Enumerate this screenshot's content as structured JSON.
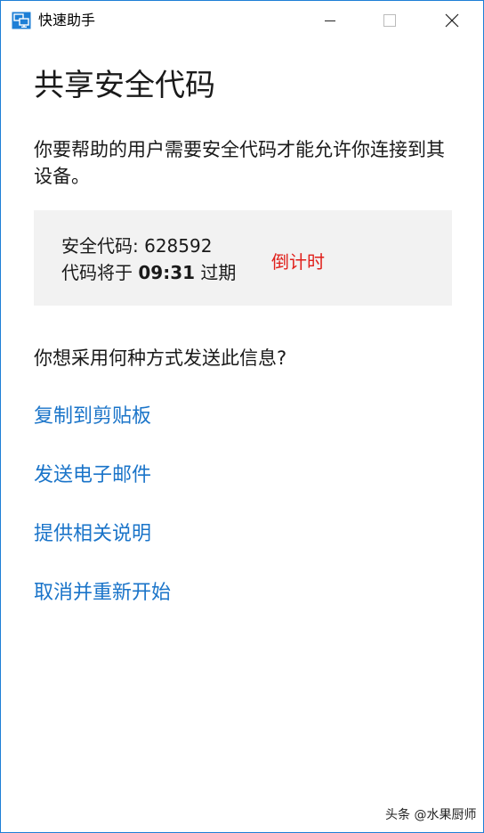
{
  "window": {
    "title": "快速助手"
  },
  "page": {
    "heading": "共享安全代码",
    "description": "你要帮助的用户需要安全代码才能允许你连接到其设备。"
  },
  "code_box": {
    "code_label": "安全代码: ",
    "code_value": "628592",
    "expire_prefix": "代码将于 ",
    "expire_time": "09:31",
    "expire_suffix": " 过期",
    "annotation": "倒计时"
  },
  "send": {
    "question": "你想采用何种方式发送此信息?",
    "links": {
      "copy": "复制到剪贴板",
      "email": "发送电子邮件",
      "instructions": "提供相关说明",
      "cancel": "取消并重新开始"
    }
  },
  "watermark": "头条 @水果厨师",
  "colors": {
    "accent_link": "#1a74c9",
    "annotation_red": "#e0201b",
    "window_border": "#1e7fd6",
    "code_box_bg": "#f2f2f2"
  },
  "icons": {
    "app": "remote-monitor-icon",
    "minimize": "minimize-icon",
    "maximize": "maximize-icon",
    "close": "close-icon"
  }
}
